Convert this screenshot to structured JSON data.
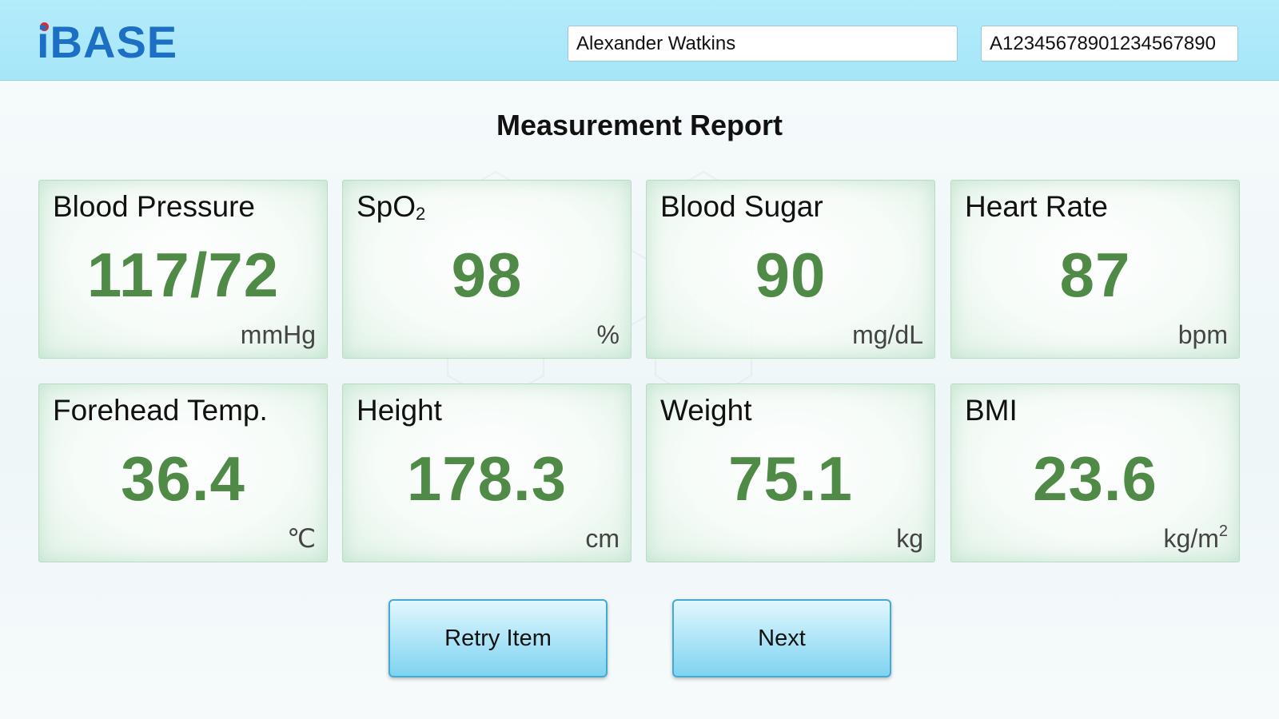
{
  "header": {
    "logo_text": "iBASE",
    "patient_name": "Alexander Watkins",
    "patient_id": "A12345678901234567890"
  },
  "page": {
    "title": "Measurement Report"
  },
  "measurements": [
    {
      "label": "Blood Pressure",
      "value": "117/72",
      "unit": "mmHg"
    },
    {
      "label": "SpO",
      "label_sub": "2",
      "value": "98",
      "unit": "%"
    },
    {
      "label": "Blood Sugar",
      "value": "90",
      "unit": "mg/dL"
    },
    {
      "label": "Heart Rate",
      "value": "87",
      "unit": "bpm"
    },
    {
      "label": "Forehead Temp.",
      "value": "36.4",
      "unit": "℃"
    },
    {
      "label": "Height",
      "value": "178.3",
      "unit": "cm"
    },
    {
      "label": "Weight",
      "value": "75.1",
      "unit": "kg"
    },
    {
      "label": "BMI",
      "value": "23.6",
      "unit": "kg/m",
      "unit_sup": "2"
    }
  ],
  "buttons": {
    "retry_label": "Retry Item",
    "next_label": "Next"
  },
  "colors": {
    "header_bg": "#a6e6f8",
    "logo": "#1c6fc3",
    "logo_dot": "#e3262f",
    "value_green": "#4f8a47",
    "card_border": "#b9dcc2",
    "button_blue": "#7fd3f1"
  }
}
